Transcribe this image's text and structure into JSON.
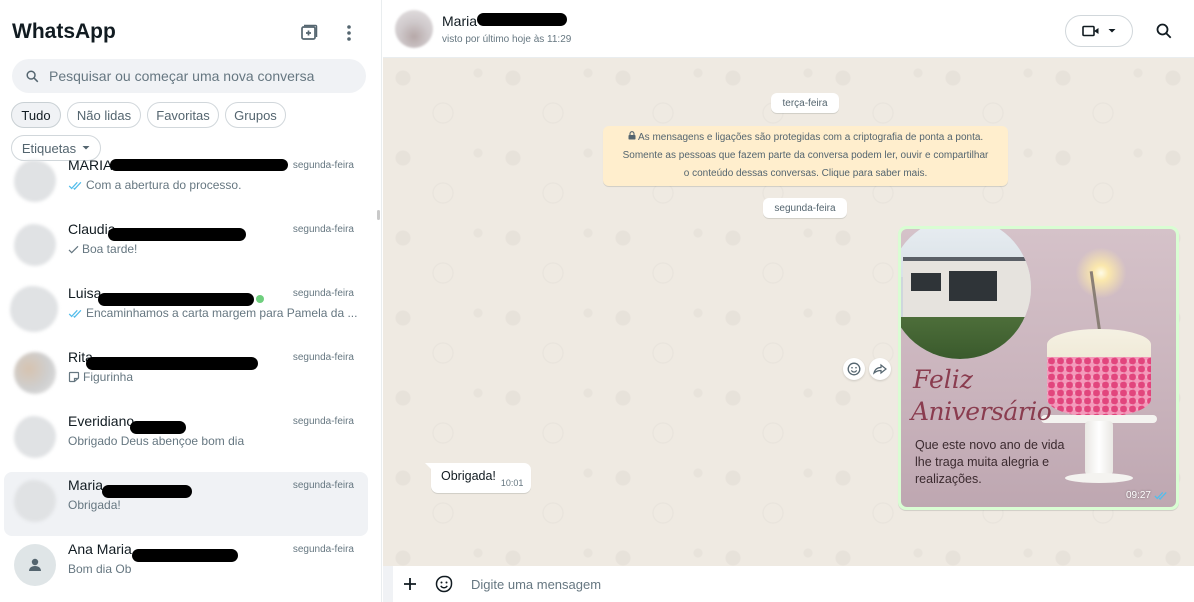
{
  "app": {
    "title": "WhatsApp"
  },
  "search": {
    "placeholder": "Pesquisar ou começar uma nova conversa"
  },
  "filters": [
    "Tudo",
    "Não lidas",
    "Favoritas",
    "Grupos",
    "Etiquetas"
  ],
  "chats": [
    {
      "name": "MARIA",
      "time": "segunda-feira",
      "preview": "Com a abertura do processo.",
      "status": "read"
    },
    {
      "name": "Claudia",
      "time": "segunda-feira",
      "preview": "Boa tarde!",
      "status": "sent"
    },
    {
      "name": "Luisa",
      "time": "segunda-feira",
      "preview": "Encaminhamos a carta margem para Pamela da ...",
      "status": "read"
    },
    {
      "name": "Rita",
      "time": "segunda-feira",
      "preview": "Figurinha",
      "status": "sticker"
    },
    {
      "name": "Everidiano",
      "time": "segunda-feira",
      "preview": "Obrigado Deus abençoe bom dia",
      "status": "none"
    },
    {
      "name": "Maria",
      "time": "segunda-feira",
      "preview": "Obrigada!",
      "status": "none"
    },
    {
      "name": "Ana Maria",
      "time": "segunda-feira",
      "preview": "Bom dia  Ob",
      "status": "none"
    }
  ],
  "conversation": {
    "contact_name": "Maria",
    "last_seen": "visto por último hoje às 11:29",
    "date_1": "terça-feira",
    "encryption_notice": [
      "As mensagens e ligações são protegidas com a criptografia de ponta a ponta.",
      "Somente as pessoas que fazem parte da conversa podem ler, ouvir e compartilhar",
      "o conteúdo dessas conversas. Clique para saber mais."
    ],
    "date_2": "segunda-feira",
    "image_message": {
      "title_line1": "Feliz",
      "title_line2": "Aniversário",
      "caption": "Que este novo ano de vida lhe traga muita alegria e realizações.",
      "time": "09:27"
    },
    "incoming_message": {
      "text": "Obrigada!",
      "time": "10:01"
    },
    "composer_placeholder": "Digite uma mensagem"
  },
  "colors": {
    "read_ticks": "#53bdeb",
    "chat_bg": "#efeae2",
    "outgoing_bubble": "#d9fdd3",
    "notice_bg": "#ffeecd"
  }
}
